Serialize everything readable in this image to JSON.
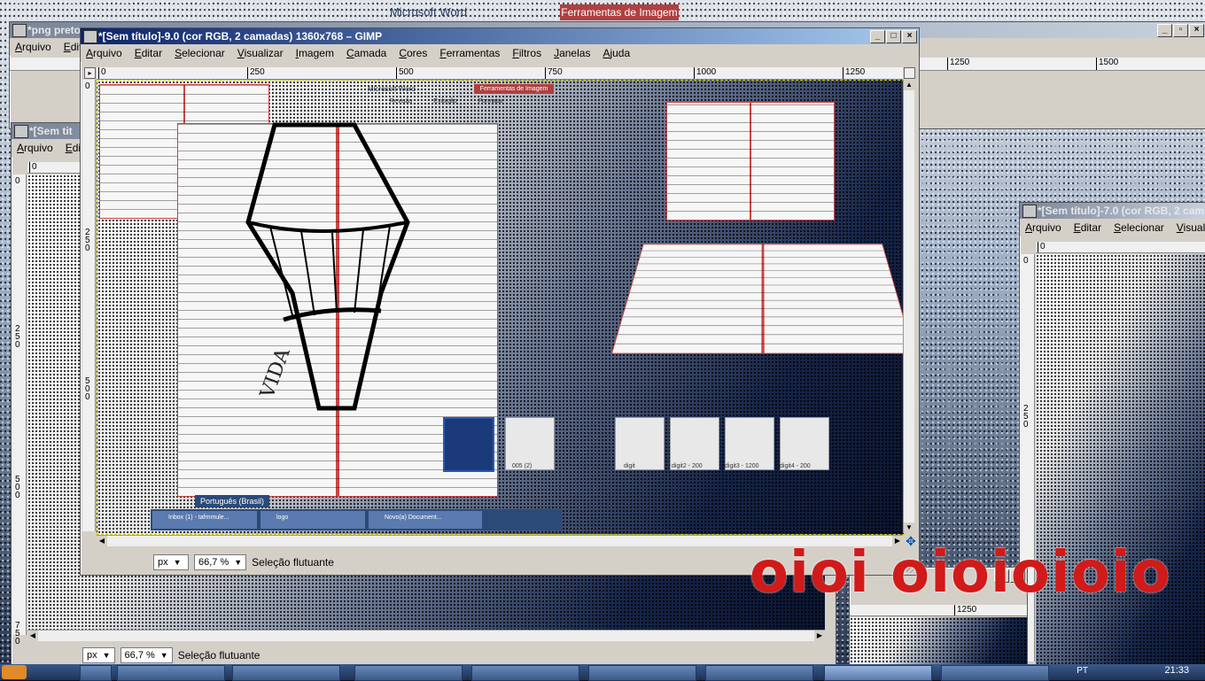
{
  "colors": {
    "title_active": "#0b246a",
    "title_gradient_end": "#a6caf0",
    "chrome": "#d4d0c8",
    "graffiti": "#d11a1a"
  },
  "background_windows": {
    "top_word_title": "Microsoft Word",
    "top_tools_tab": "Ferramentas de Imagem",
    "png_window_title": "*png preto",
    "png_menu": [
      "Arquivo",
      "Edit"
    ],
    "png_ruler": [
      "1250",
      "1500"
    ],
    "left_window_title": "*[Sem tit",
    "left_menu": [
      "Arquivo",
      "Edi"
    ],
    "left_ruler_zero": "0",
    "left_vruler": [
      "0",
      "250",
      "500",
      "750"
    ],
    "right_window_title": "*[Sem título]-7.0 (cor RGB, 2 cam",
    "right_menu": [
      "Arquivo",
      "Editar",
      "Selecionar",
      "Visualiz"
    ],
    "right_ruler": [
      "0",
      "250"
    ],
    "bottom_ruler_label": "1250",
    "bottom_status": {
      "unit": "px",
      "zoom": "66,7 %",
      "message": "Seleção flutuante"
    }
  },
  "gimp": {
    "title": "*[Sem título]-9.0 (cor RGB, 2 camadas) 1360x768 – GIMP",
    "menu": [
      "Arquivo",
      "Editar",
      "Selecionar",
      "Visualizar",
      "Imagem",
      "Camada",
      "Cores",
      "Ferramentas",
      "Filtros",
      "Janelas",
      "Ajuda"
    ],
    "h_ruler": [
      "0",
      "250",
      "500",
      "750",
      "1000",
      "1250"
    ],
    "v_ruler": [
      "0",
      "250",
      "500"
    ],
    "status": {
      "unit": "px",
      "zoom": "66,7 %",
      "message": "Seleção flutuante"
    }
  },
  "canvas_content": {
    "word_title": "Microsoft Word",
    "word_tools_tab": "Ferramentas de Imagem",
    "ribbon_tabs": [
      "Revisão",
      "Exibição",
      "Formatar"
    ],
    "thumb_labels": [
      "005 (2)",
      "digit",
      "digit2 - 200",
      "digit3 - 1200",
      "digit4 - 200"
    ],
    "language": "Português (Brasil)",
    "task_items": [
      "Inbox (1) - tafmmule...",
      "logo",
      "Novo(a) Document..."
    ],
    "sketch_word": "VIDA"
  },
  "graffiti_text": "oioi oioioioio",
  "taskbar": {
    "language": "PT",
    "time": "21:33"
  }
}
